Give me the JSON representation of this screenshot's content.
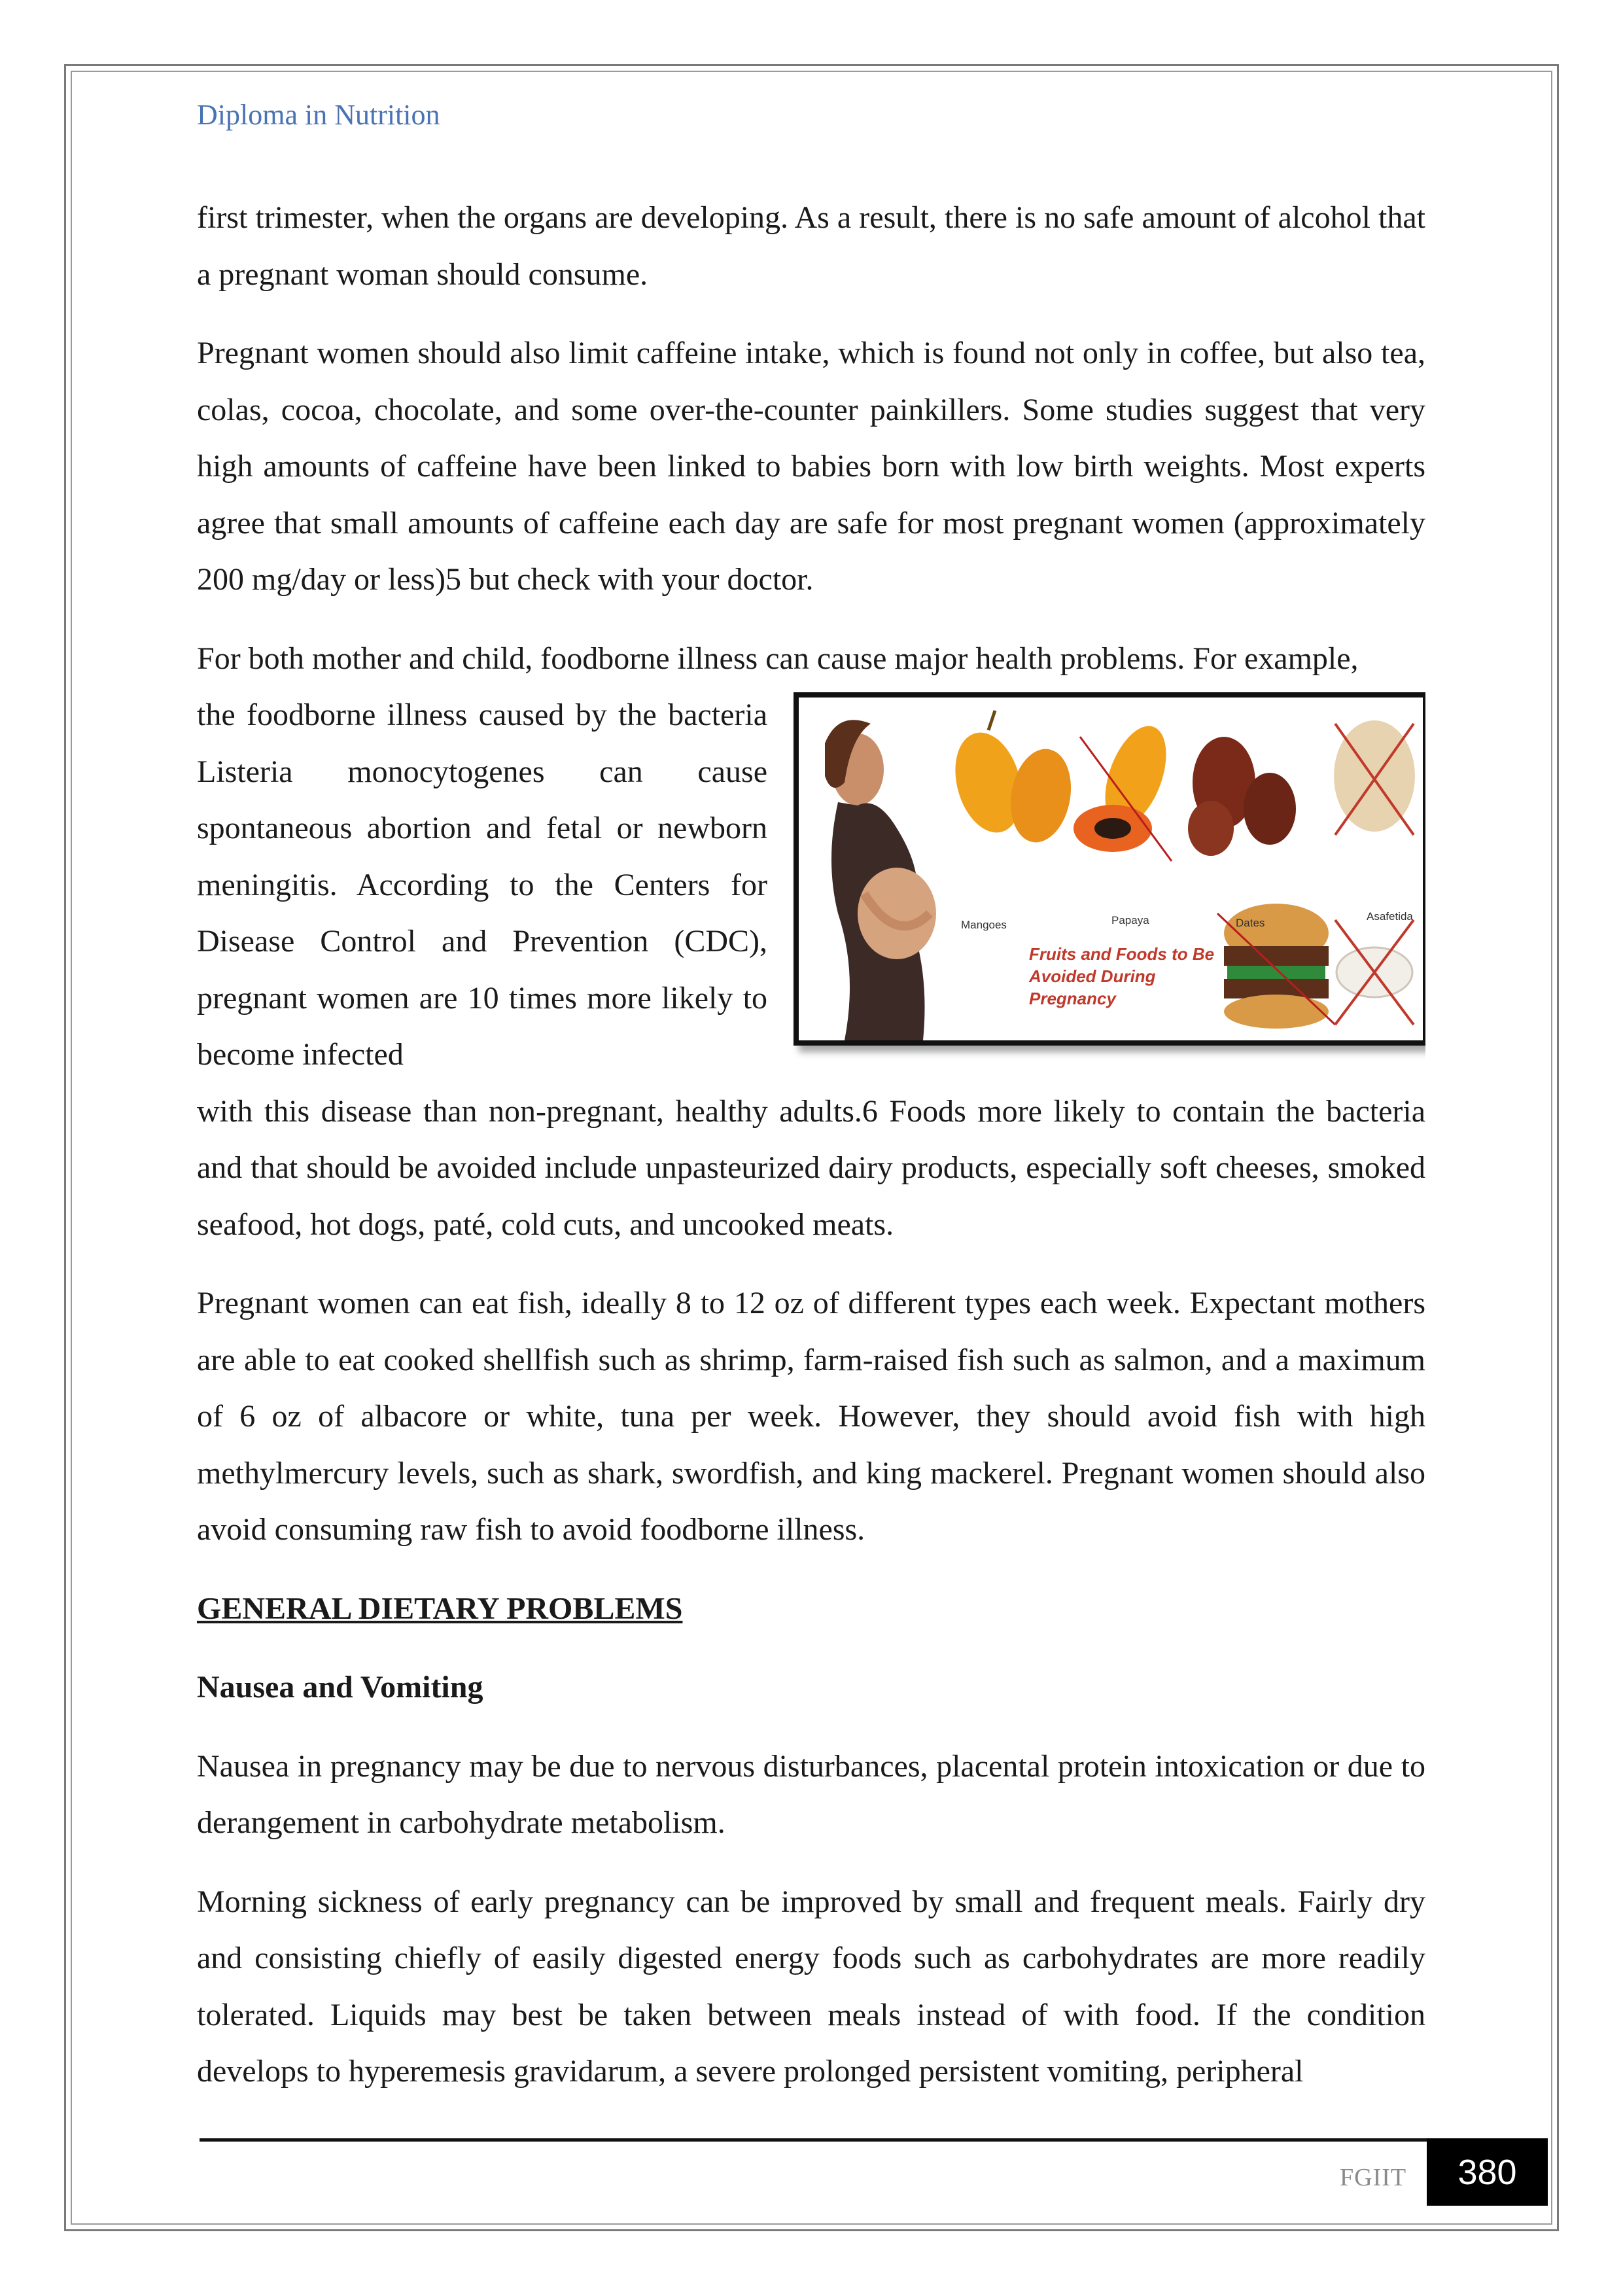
{
  "header": {
    "title": "Diploma in Nutrition"
  },
  "paragraphs": {
    "p1": "first trimester, when the organs are developing. As a result, there is no safe amount of alcohol that a pregnant woman should consume.",
    "p2": "Pregnant women should also limit caffeine intake, which is found not only in coffee, but also tea, colas, cocoa, chocolate, and some over-the-counter painkillers. Some studies suggest that very high amounts of caffeine have been linked to babies born with low birth weights. Most experts agree that small amounts of caffeine each day are safe for most pregnant women (approximately 200 mg/day or less)5  but check with your doctor.",
    "p3_lead": "For both mother and child, foodborne illness can cause major health problems. For example,",
    "p3_wrap": "the foodborne illness caused by the bacteria Listeria monocytogenes can cause spontaneous abortion and fetal or newborn meningitis. According to the Centers for Disease Control and Prevention (CDC), pregnant women are 10 times more likely to become infected",
    "p3_tail": "with this disease than non-pregnant, healthy adults.6 Foods more likely to contain the bacteria and that should be avoided include unpasteurized dairy products, especially soft cheeses, smoked seafood, hot dogs, paté, cold cuts, and uncooked meats.",
    "p4": "Pregnant women can eat fish, ideally 8 to 12 oz of different types each week. Expectant mothers are able to eat cooked shellfish such as shrimp, farm-raised fish such as salmon, and a maximum of 6 oz of albacore or white, tuna per week. However, they should avoid fish with high methylmercury levels, such as shark, swordfish, and king mackerel. Pregnant women should also avoid consuming raw fish to avoid foodborne illness.",
    "p5": "Nausea in pregnancy may be due to nervous disturbances, placental protein intoxication or due to derangement in carbohydrate metabolism.",
    "p6": "Morning sickness of early pregnancy can be improved by small and frequent meals. Fairly dry and consisting chiefly of easily digested energy foods such as carbohydrates are more readily tolerated. Liquids may best be taken between meals instead of with food. If the condition develops to hyperemesis gravidarum, a severe prolonged persistent vomiting, peripheral"
  },
  "headings": {
    "section": "GENERAL DIETARY PROBLEMS",
    "subsection": "Nausea and Vomiting"
  },
  "figure": {
    "labels": {
      "mangoes": "Mangoes",
      "papaya": "Papaya",
      "dates": "Dates",
      "asafetida": "Asafetida"
    },
    "caption": "Fruits and Foods to Be\nAvoided During\nPregnancy"
  },
  "footer": {
    "org": "FGIIT",
    "page_number": "380"
  }
}
